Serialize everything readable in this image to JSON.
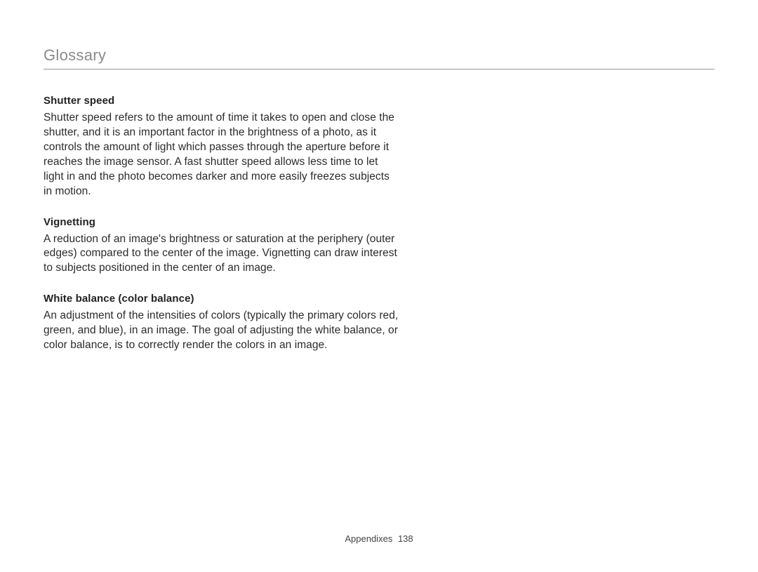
{
  "header": {
    "section_title": "Glossary"
  },
  "entries": [
    {
      "term": "Shutter speed",
      "definition": "Shutter speed refers to the amount of time it takes to open and close the shutter, and it is an important factor in the brightness of a photo, as it controls the amount of light which passes through the aperture before it reaches the image sensor. A fast shutter speed allows less time to let light in and the photo becomes darker and more easily freezes subjects in motion."
    },
    {
      "term": "Vignetting",
      "definition": "A reduction of an image's brightness or saturation at the periphery (outer edges) compared to the center of the image. Vignetting can draw interest to subjects positioned in the center of an image."
    },
    {
      "term": "White balance (color balance)",
      "definition": "An adjustment of the intensities of colors (typically the primary colors red, green, and blue), in an image. The goal of adjusting the white balance, or color balance, is to correctly render the colors in an image."
    }
  ],
  "footer": {
    "section": "Appendixes",
    "page_number": "138"
  }
}
